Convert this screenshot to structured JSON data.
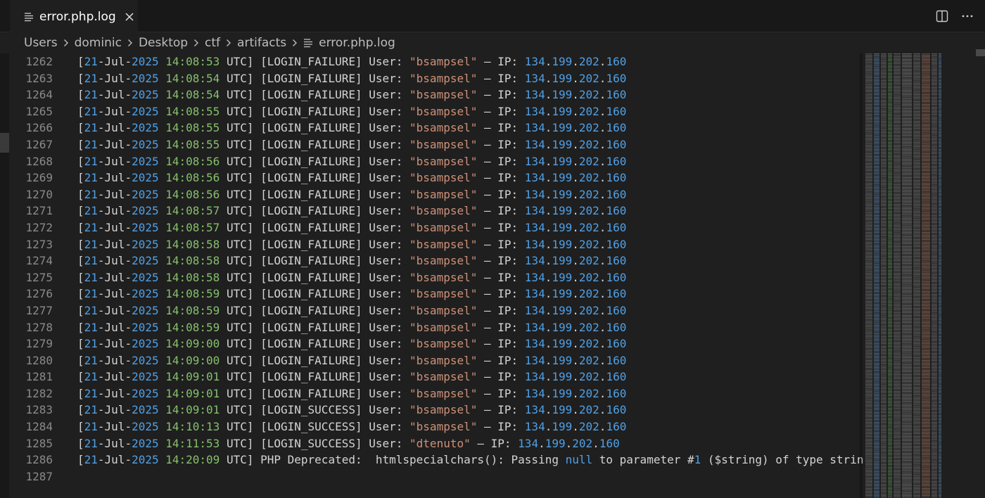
{
  "tab": {
    "title": "error.php.log"
  },
  "breadcrumb": {
    "items": [
      "Users",
      "dominic",
      "Desktop",
      "ctf",
      "artifacts"
    ],
    "file": "error.php.log"
  },
  "editor": {
    "lines": [
      {
        "num": "1262",
        "prefix": "[",
        "day": "21",
        "mon": "-Jul-",
        "year": "2025",
        "time": "14:08:53",
        "rest": " UTC] [LOGIN_FAILURE] User: ",
        "user": "\"bsampsel\"",
        "dash": " – IP: ",
        "ip": [
          "134",
          "199",
          "202",
          "160"
        ]
      },
      {
        "num": "1263",
        "prefix": "[",
        "day": "21",
        "mon": "-Jul-",
        "year": "2025",
        "time": "14:08:54",
        "rest": " UTC] [LOGIN_FAILURE] User: ",
        "user": "\"bsampsel\"",
        "dash": " – IP: ",
        "ip": [
          "134",
          "199",
          "202",
          "160"
        ]
      },
      {
        "num": "1264",
        "prefix": "[",
        "day": "21",
        "mon": "-Jul-",
        "year": "2025",
        "time": "14:08:54",
        "rest": " UTC] [LOGIN_FAILURE] User: ",
        "user": "\"bsampsel\"",
        "dash": " – IP: ",
        "ip": [
          "134",
          "199",
          "202",
          "160"
        ]
      },
      {
        "num": "1265",
        "prefix": "[",
        "day": "21",
        "mon": "-Jul-",
        "year": "2025",
        "time": "14:08:55",
        "rest": " UTC] [LOGIN_FAILURE] User: ",
        "user": "\"bsampsel\"",
        "dash": " – IP: ",
        "ip": [
          "134",
          "199",
          "202",
          "160"
        ]
      },
      {
        "num": "1266",
        "prefix": "[",
        "day": "21",
        "mon": "-Jul-",
        "year": "2025",
        "time": "14:08:55",
        "rest": " UTC] [LOGIN_FAILURE] User: ",
        "user": "\"bsampsel\"",
        "dash": " – IP: ",
        "ip": [
          "134",
          "199",
          "202",
          "160"
        ]
      },
      {
        "num": "1267",
        "prefix": "[",
        "day": "21",
        "mon": "-Jul-",
        "year": "2025",
        "time": "14:08:55",
        "rest": " UTC] [LOGIN_FAILURE] User: ",
        "user": "\"bsampsel\"",
        "dash": " – IP: ",
        "ip": [
          "134",
          "199",
          "202",
          "160"
        ]
      },
      {
        "num": "1268",
        "prefix": "[",
        "day": "21",
        "mon": "-Jul-",
        "year": "2025",
        "time": "14:08:56",
        "rest": " UTC] [LOGIN_FAILURE] User: ",
        "user": "\"bsampsel\"",
        "dash": " – IP: ",
        "ip": [
          "134",
          "199",
          "202",
          "160"
        ]
      },
      {
        "num": "1269",
        "prefix": "[",
        "day": "21",
        "mon": "-Jul-",
        "year": "2025",
        "time": "14:08:56",
        "rest": " UTC] [LOGIN_FAILURE] User: ",
        "user": "\"bsampsel\"",
        "dash": " – IP: ",
        "ip": [
          "134",
          "199",
          "202",
          "160"
        ]
      },
      {
        "num": "1270",
        "prefix": "[",
        "day": "21",
        "mon": "-Jul-",
        "year": "2025",
        "time": "14:08:56",
        "rest": " UTC] [LOGIN_FAILURE] User: ",
        "user": "\"bsampsel\"",
        "dash": " – IP: ",
        "ip": [
          "134",
          "199",
          "202",
          "160"
        ]
      },
      {
        "num": "1271",
        "prefix": "[",
        "day": "21",
        "mon": "-Jul-",
        "year": "2025",
        "time": "14:08:57",
        "rest": " UTC] [LOGIN_FAILURE] User: ",
        "user": "\"bsampsel\"",
        "dash": " – IP: ",
        "ip": [
          "134",
          "199",
          "202",
          "160"
        ]
      },
      {
        "num": "1272",
        "prefix": "[",
        "day": "21",
        "mon": "-Jul-",
        "year": "2025",
        "time": "14:08:57",
        "rest": " UTC] [LOGIN_FAILURE] User: ",
        "user": "\"bsampsel\"",
        "dash": " – IP: ",
        "ip": [
          "134",
          "199",
          "202",
          "160"
        ]
      },
      {
        "num": "1273",
        "prefix": "[",
        "day": "21",
        "mon": "-Jul-",
        "year": "2025",
        "time": "14:08:58",
        "rest": " UTC] [LOGIN_FAILURE] User: ",
        "user": "\"bsampsel\"",
        "dash": " – IP: ",
        "ip": [
          "134",
          "199",
          "202",
          "160"
        ]
      },
      {
        "num": "1274",
        "prefix": "[",
        "day": "21",
        "mon": "-Jul-",
        "year": "2025",
        "time": "14:08:58",
        "rest": " UTC] [LOGIN_FAILURE] User: ",
        "user": "\"bsampsel\"",
        "dash": " – IP: ",
        "ip": [
          "134",
          "199",
          "202",
          "160"
        ]
      },
      {
        "num": "1275",
        "prefix": "[",
        "day": "21",
        "mon": "-Jul-",
        "year": "2025",
        "time": "14:08:58",
        "rest": " UTC] [LOGIN_FAILURE] User: ",
        "user": "\"bsampsel\"",
        "dash": " – IP: ",
        "ip": [
          "134",
          "199",
          "202",
          "160"
        ]
      },
      {
        "num": "1276",
        "prefix": "[",
        "day": "21",
        "mon": "-Jul-",
        "year": "2025",
        "time": "14:08:59",
        "rest": " UTC] [LOGIN_FAILURE] User: ",
        "user": "\"bsampsel\"",
        "dash": " – IP: ",
        "ip": [
          "134",
          "199",
          "202",
          "160"
        ]
      },
      {
        "num": "1277",
        "prefix": "[",
        "day": "21",
        "mon": "-Jul-",
        "year": "2025",
        "time": "14:08:59",
        "rest": " UTC] [LOGIN_FAILURE] User: ",
        "user": "\"bsampsel\"",
        "dash": " – IP: ",
        "ip": [
          "134",
          "199",
          "202",
          "160"
        ]
      },
      {
        "num": "1278",
        "prefix": "[",
        "day": "21",
        "mon": "-Jul-",
        "year": "2025",
        "time": "14:08:59",
        "rest": " UTC] [LOGIN_FAILURE] User: ",
        "user": "\"bsampsel\"",
        "dash": " – IP: ",
        "ip": [
          "134",
          "199",
          "202",
          "160"
        ]
      },
      {
        "num": "1279",
        "prefix": "[",
        "day": "21",
        "mon": "-Jul-",
        "year": "2025",
        "time": "14:09:00",
        "rest": " UTC] [LOGIN_FAILURE] User: ",
        "user": "\"bsampsel\"",
        "dash": " – IP: ",
        "ip": [
          "134",
          "199",
          "202",
          "160"
        ]
      },
      {
        "num": "1280",
        "prefix": "[",
        "day": "21",
        "mon": "-Jul-",
        "year": "2025",
        "time": "14:09:00",
        "rest": " UTC] [LOGIN_FAILURE] User: ",
        "user": "\"bsampsel\"",
        "dash": " – IP: ",
        "ip": [
          "134",
          "199",
          "202",
          "160"
        ]
      },
      {
        "num": "1281",
        "prefix": "[",
        "day": "21",
        "mon": "-Jul-",
        "year": "2025",
        "time": "14:09:01",
        "rest": " UTC] [LOGIN_FAILURE] User: ",
        "user": "\"bsampsel\"",
        "dash": " – IP: ",
        "ip": [
          "134",
          "199",
          "202",
          "160"
        ]
      },
      {
        "num": "1282",
        "prefix": "[",
        "day": "21",
        "mon": "-Jul-",
        "year": "2025",
        "time": "14:09:01",
        "rest": " UTC] [LOGIN_FAILURE] User: ",
        "user": "\"bsampsel\"",
        "dash": " – IP: ",
        "ip": [
          "134",
          "199",
          "202",
          "160"
        ]
      },
      {
        "num": "1283",
        "prefix": "[",
        "day": "21",
        "mon": "-Jul-",
        "year": "2025",
        "time": "14:09:01",
        "rest": " UTC] [LOGIN_SUCCESS] User: ",
        "user": "\"bsampsel\"",
        "dash": " – IP: ",
        "ip": [
          "134",
          "199",
          "202",
          "160"
        ]
      },
      {
        "num": "1284",
        "prefix": "[",
        "day": "21",
        "mon": "-Jul-",
        "year": "2025",
        "time": "14:10:13",
        "rest": " UTC] [LOGIN_SUCCESS] User: ",
        "user": "\"bsampsel\"",
        "dash": " – IP: ",
        "ip": [
          "134",
          "199",
          "202",
          "160"
        ]
      },
      {
        "num": "1285",
        "prefix": "[",
        "day": "21",
        "mon": "-Jul-",
        "year": "2025",
        "time": "14:11:53",
        "rest": " UTC] [LOGIN_SUCCESS] User: ",
        "user": "\"dtenuto\"",
        "dash": " – IP: ",
        "ip": [
          "134",
          "199",
          "202",
          "160"
        ]
      }
    ],
    "deprecated_line": {
      "num": "1286",
      "prefix": "[",
      "day": "21",
      "mon": "-Jul-",
      "year": "2025",
      "time": "14:20:09",
      "text_a": " UTC] PHP Deprecated:  htmlspecialchars(): Passing ",
      "kw_null": "null",
      "text_b": " to parameter #",
      "num_1": "1",
      "text_c": " ($string) of type string"
    },
    "empty_line_num": "1287"
  },
  "colors": {
    "background": "#1f1f1f",
    "line_number": "#8a8a8a",
    "text": "#d4d4d4",
    "number": "#4fa0e6",
    "time": "#86c06c",
    "string": "#ce9178"
  },
  "icons": [
    "file-lines-icon",
    "close-icon",
    "split-editor-icon",
    "more-actions-icon",
    "chevron-right-icon"
  ]
}
